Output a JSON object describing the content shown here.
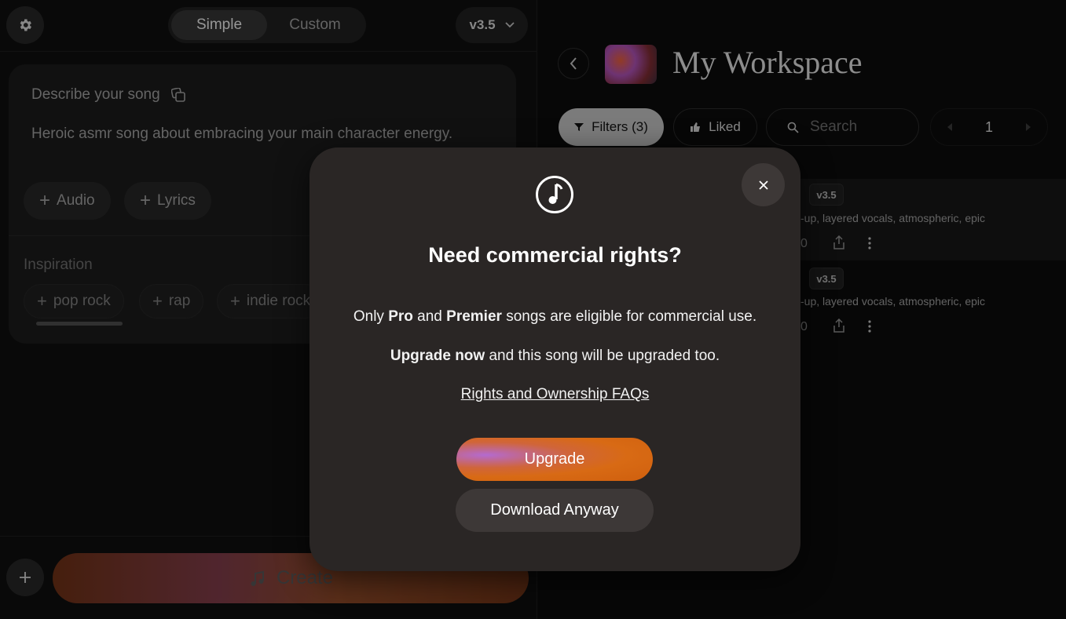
{
  "left_panel": {
    "mode_toggle": {
      "simple_label": "Simple",
      "custom_label": "Custom",
      "active": "Simple"
    },
    "version_label": "v3.5",
    "prompt_card": {
      "title": "Describe your song",
      "prompt_text": "Heroic asmr song about embracing your main character energy.",
      "audio_label": "Audio",
      "lyrics_label": "Lyrics"
    },
    "inspiration": {
      "label": "Inspiration",
      "chips": [
        "pop rock",
        "rap",
        "indie rock"
      ]
    },
    "create_label": "Create"
  },
  "right_panel": {
    "workspace_title": "My Workspace",
    "filters_label": "Filters (3)",
    "liked_label": "Liked",
    "search_placeholder": "Search",
    "page_number": "1",
    "rows": [
      {
        "version": "v3.5",
        "tags": "-up, layered vocals, atmospheric, epic",
        "count": "0"
      },
      {
        "version": "v3.5",
        "tags": "-up, layered vocals, atmospheric, epic",
        "count": "0"
      }
    ]
  },
  "modal": {
    "title": "Need commercial rights?",
    "line1_prefix": "Only ",
    "line1_pro": "Pro",
    "line1_and": " and ",
    "line1_premier": "Premier",
    "line1_suffix": " songs are eligible for commercial use.",
    "line2_bold": "Upgrade now",
    "line2_suffix": " and this song will be upgraded too.",
    "faq_link": "Rights and Ownership FAQs",
    "upgrade_label": "Upgrade",
    "download_label": "Download Anyway"
  },
  "colors": {
    "accent_orange": "#d86a14",
    "modal_bg": "#2a2625",
    "filters_bg": "#bdbdbd"
  }
}
